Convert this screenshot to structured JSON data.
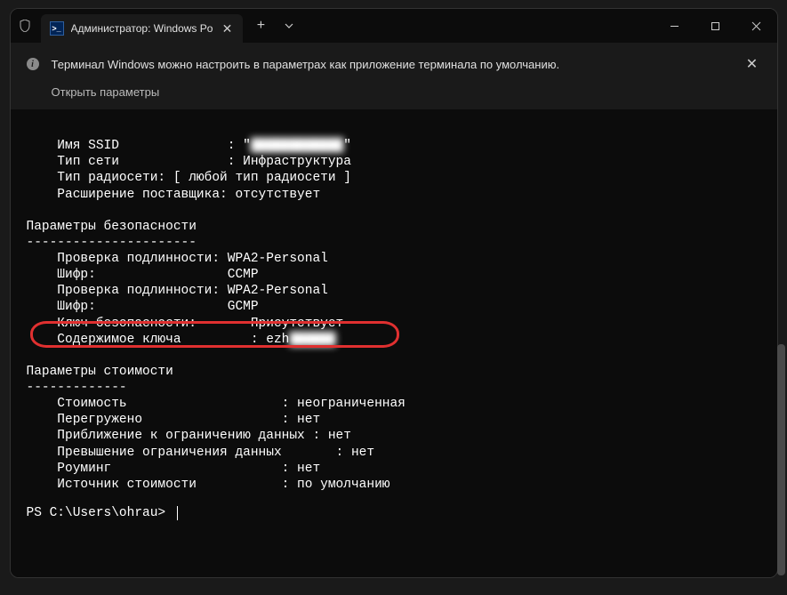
{
  "tab": {
    "title": "Администратор: Windows Po"
  },
  "infobar": {
    "text": "Терминал Windows можно настроить в параметрах как приложение терминала по умолчанию.",
    "link": "Открыть параметры"
  },
  "terminal": {
    "lines": {
      "l1": "    Имя SSID              : \"",
      "l1blur": "████████████",
      "l1end": "\"",
      "l2": "    Тип сети              : Инфраструктура",
      "l3": "    Тип радиосети: [ любой тип радиосети ]",
      "l4": "    Расширение поставщика: отсутствует",
      "s1": "Параметры безопасности",
      "s1div": "----------------------",
      "l5": "    Проверка подлинности: WPA2-Personal",
      "l6": "    Шифр:                 CCMP",
      "l7": "    Проверка подлинности: WPA2-Personal",
      "l8": "    Шифр:                 GCMP",
      "l9": "    Ключ безопасности:       Присутствует",
      "l10a": "    Содержимое ключа         : ezh",
      "l10blur": "██████",
      "s2": "Параметры стоимости",
      "s2div": "-------------",
      "l11": "    Стоимость                    : неограниченная",
      "l12": "    Перегружено                  : нет",
      "l13": "    Приближение к ограничению данных : нет",
      "l14": "    Превышение ограничения данных       : нет",
      "l15": "    Роуминг                      : нет",
      "l16": "    Источник стоимости           : по умолчанию"
    },
    "prompt": "PS C:\\Users\\ohrau> "
  }
}
